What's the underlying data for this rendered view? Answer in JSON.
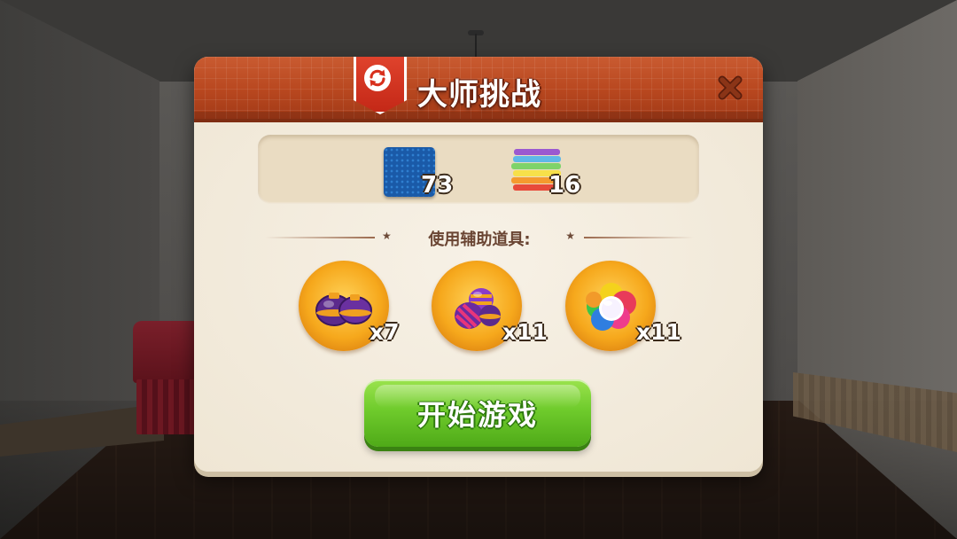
{
  "dialog": {
    "title": "大师挑战",
    "close_icon": "close-icon",
    "badge_icon": "refresh-icon"
  },
  "targets": [
    {
      "name": "blue-carpet",
      "icon": "blue-carpet-icon",
      "count": "73"
    },
    {
      "name": "towel-stack",
      "icon": "towel-stack-icon",
      "count": "16"
    }
  ],
  "boosters_label": "使用辅助道具:",
  "boosters": [
    {
      "name": "purple-bombs",
      "icon": "purple-bombs-icon",
      "quantity": "x7"
    },
    {
      "name": "striped-candy",
      "icon": "striped-candy-icon",
      "quantity": "x11"
    },
    {
      "name": "rainbow-ball",
      "icon": "rainbow-ball-icon",
      "quantity": "x11"
    }
  ],
  "start_button": {
    "label": "开始游戏"
  },
  "colors": {
    "header": "#b8471f",
    "panel": "#f4ede0",
    "start_button": "#6fcb2c",
    "booster_circle": "#f6a81c"
  }
}
